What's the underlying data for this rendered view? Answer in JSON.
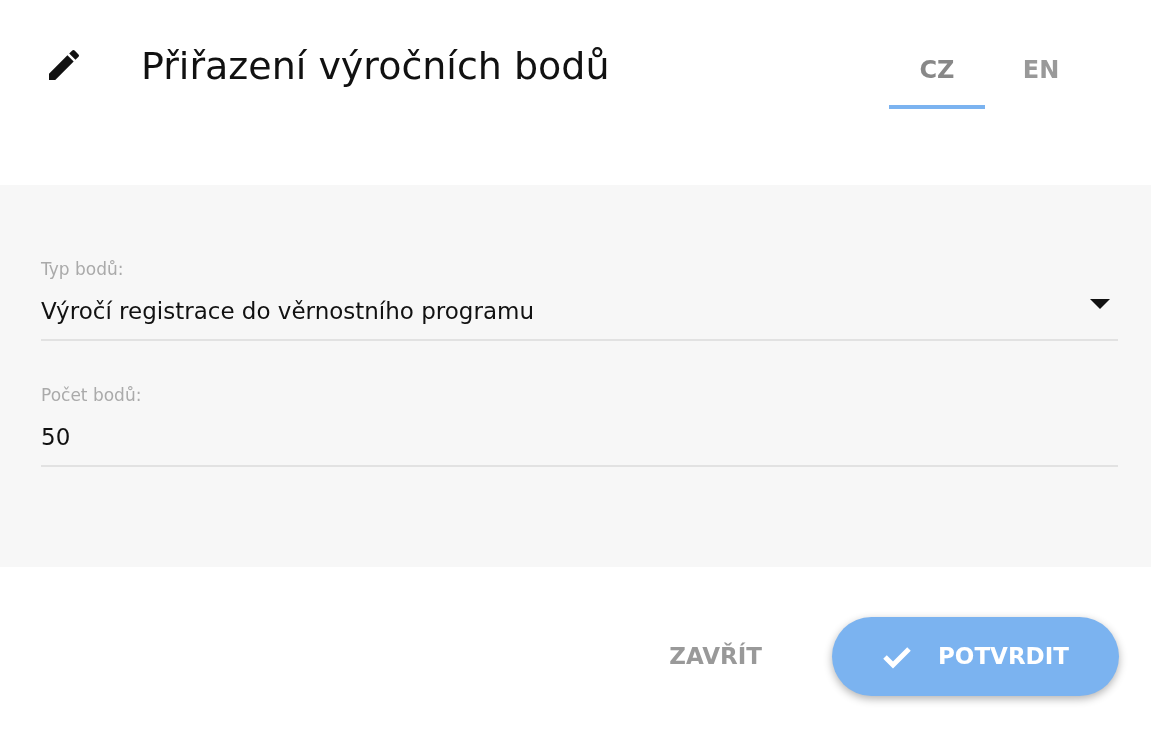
{
  "dialog": {
    "title": "Přiřazení výročních bodů"
  },
  "language_tabs": [
    {
      "label": "CZ",
      "selected": true
    },
    {
      "label": "EN",
      "selected": false
    }
  ],
  "fields": [
    {
      "kind": "select",
      "label": "Typ bodů:",
      "value": "Výročí registrace do věrnostního programu"
    },
    {
      "kind": "text",
      "label": "Počet bodů:",
      "value": "50"
    }
  ],
  "buttons": [
    {
      "kind": "text",
      "label": "ZAVŘÍT"
    },
    {
      "kind": "primary",
      "label": "POTVRDIT"
    }
  ]
}
